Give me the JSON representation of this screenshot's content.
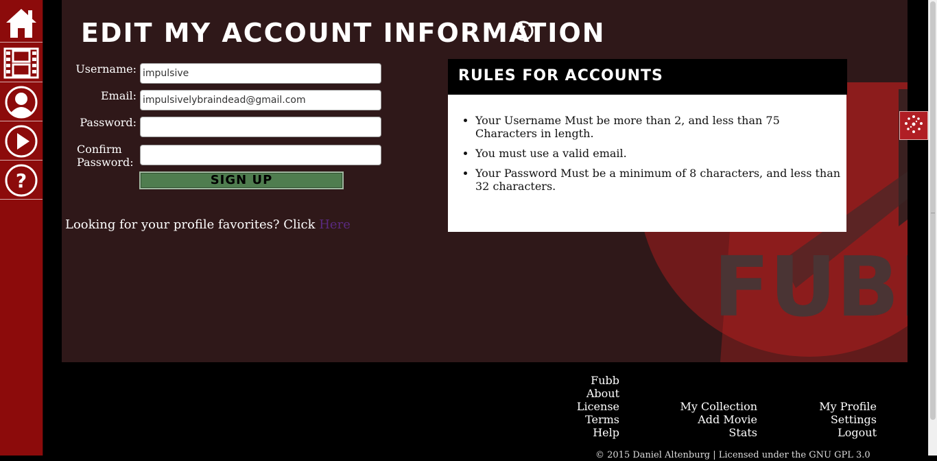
{
  "nav": {
    "items": [
      {
        "icon": "home-icon"
      },
      {
        "icon": "film-icon"
      },
      {
        "icon": "user-icon"
      },
      {
        "icon": "play-icon"
      },
      {
        "icon": "help-icon"
      }
    ]
  },
  "page": {
    "title": "Edit My Account Information",
    "back_icon": "back-circle-icon"
  },
  "form": {
    "username_label": "Username:",
    "username_value": "impulsive",
    "email_label": "Email:",
    "email_value": "impulsivelybraindead@gmail.com",
    "password_label": "Password:",
    "password_value": "",
    "confirm_label_1": "Confirm",
    "confirm_label_2": "Password:",
    "confirm_value": "",
    "submit_label": "Sign Up"
  },
  "favorites": {
    "text": "Looking for your profile favorites? Click ",
    "link": "Here"
  },
  "rules": {
    "heading": "Rules for Accounts",
    "items": [
      "Your Username Must be more than 2, and less than 75 Characters in length.",
      "You must use a valid email.",
      "Your Password Must be a minimum of 8 characters, and less than 32 characters."
    ]
  },
  "footer": {
    "col1": [
      "Fubb",
      "About",
      "License",
      "Terms",
      "Help"
    ],
    "col2": [
      "My Collection",
      "Add Movie",
      "Stats"
    ],
    "col3": [
      "My Profile",
      "Settings",
      "Logout"
    ],
    "copyright": "© 2015 Daniel Altenburg | Licensed under the GNU GPL 3.0"
  },
  "colors": {
    "rail": "#8c0b0b",
    "panel": "#2f1819",
    "button": "#4f7d4f",
    "link": "#5a2a80"
  },
  "background_art_text": "FUBB"
}
